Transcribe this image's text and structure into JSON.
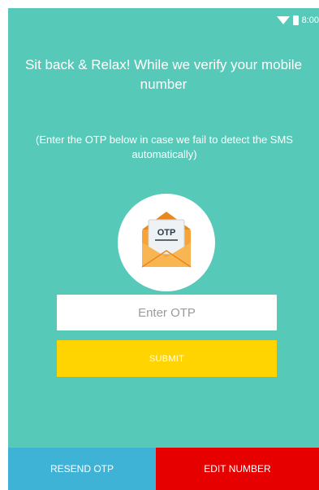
{
  "status_bar": {
    "time": "8:00"
  },
  "header": {
    "headline": "Sit back & Relax! While we verify your mobile number",
    "instruction": "(Enter the OTP below in case we fail to detect the SMS automatically)"
  },
  "illustration": {
    "envelope_label": "OTP",
    "icon": "open-envelope-icon"
  },
  "form": {
    "otp_placeholder": "Enter OTP",
    "otp_value": "",
    "submit_label": "SUBMIT"
  },
  "bottom_actions": {
    "resend_label": "RESEND OTP",
    "edit_label": "EDIT NUMBER"
  },
  "colors": {
    "background": "#57c9b8",
    "submit": "#ffd400",
    "resend": "#3fb3d6",
    "edit": "#e60000",
    "envelope": "#f6a43a"
  }
}
